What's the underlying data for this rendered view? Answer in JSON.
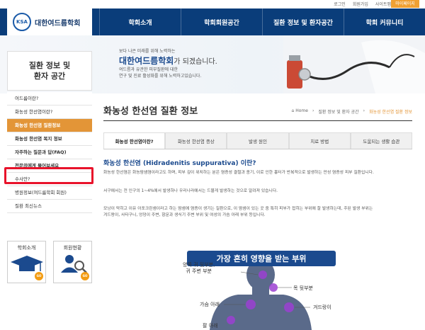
{
  "utility": {
    "links": [
      "로그인",
      "회원가입",
      "사이트맵"
    ],
    "mypage": "마이페이지"
  },
  "logo": {
    "mark": "KSA",
    "name": "대한여드름학회"
  },
  "gnb": [
    "학회소개",
    "학회회원공간",
    "질환 정보 및 환자공간",
    "학회 커뮤니티"
  ],
  "banner": {
    "sub": "보다 나은 미래를 위해 노력하는",
    "title": "대한여드름학회",
    "title_suffix": "가 되겠습니다.",
    "desc_line1": "여드름과 유관한 피부질환에 대한",
    "desc_line2": "연구 및 진료 활성화를 위해 노력하고있습니다."
  },
  "sidebar": {
    "title_line1": "질환 정보 및",
    "title_line2": "환자 공간",
    "items": [
      {
        "label": "여드름이란?"
      },
      {
        "label": "화농성 한선염이란?"
      },
      {
        "label": "화농성 한선염 질환정보"
      },
      {
        "label": "화농성 한선염 복지 정보"
      },
      {
        "label": "자주하는 질문과 답(FAQ)"
      },
      {
        "label": "전문의에게 물어보세요"
      },
      {
        "label": "수사안?"
      },
      {
        "label": "병원정보(여드름학회 회원)"
      },
      {
        "label": "질환 최신뉴스"
      }
    ],
    "cards": [
      {
        "label": "학회소개",
        "go": "GO"
      },
      {
        "label": "회원현황",
        "go": "GO"
      }
    ]
  },
  "content": {
    "title": "화농성 한선염 질환 정보",
    "breadcrumb": [
      "Home",
      "질환 정보 및 환자 공간",
      "화농성 한선염 질환 정보"
    ],
    "tabs": [
      "화농성 한선염이란?",
      "화농성 한선염 증상",
      "발생 원인",
      "치료 방법",
      "도움되는 생활 습관"
    ],
    "section_title": "화농성 한선염 (Hidradenitis suppurativa) 이란?",
    "para1": "화농성 한선염은 화농땀샘염이라고도 하며, 피부 깊이 위치하는 분은 염증성 결절과 종기, 이로 인한 흉터가 반복적으로 발생하는 만성 염증성 피부 질환입니다.",
    "para2": "서구에서는 전 인구의 1~4%에서 발생하나 우리나라에서는 드물게 발생하는 것으로 알려져 있습니다.",
    "para3_line1": "모낭이 막히고 이유 아포크린샘이라고 하는 땀샘에 염증이 생기는 질환으로, 이 땀샘이 있는 곳 중 특히 피부가 접히는 부위에 잘 발생하는데, 주된 발생 부위는",
    "para3_line2": "겨드랑이, 사타구니, 엉덩이 주변, 항문과 생식기 주변 부위 및 여성의 가슴 아래 부위 등입니다.",
    "figure_title": "가장 흔히 영향을 받는 부위",
    "body_labels": {
      "neck_back_line1": "양쪽 귀 뒷부분,",
      "neck_back_line2": "귀 주변 부분",
      "neck": "목 뒷부분",
      "chest": "가슴 아래",
      "armpit": "겨드랑이",
      "arm": "팔 아래"
    }
  }
}
